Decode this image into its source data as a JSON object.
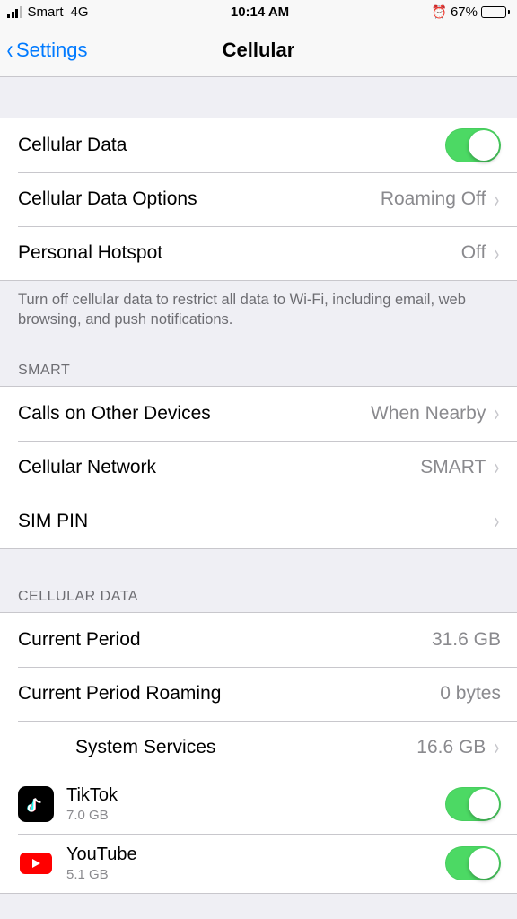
{
  "status": {
    "carrier": "Smart",
    "network": "4G",
    "time": "10:14 AM",
    "battery_pct": "67%"
  },
  "nav": {
    "back": "Settings",
    "title": "Cellular"
  },
  "main": {
    "cellular_data": "Cellular Data",
    "options_label": "Cellular Data Options",
    "options_value": "Roaming Off",
    "hotspot_label": "Personal Hotspot",
    "hotspot_value": "Off",
    "footer": "Turn off cellular data to restrict all data to Wi-Fi, including email, web browsing, and push notifications."
  },
  "smart_section": {
    "header": "SMART",
    "calls_label": "Calls on Other Devices",
    "calls_value": "When Nearby",
    "network_label": "Cellular Network",
    "network_value": "SMART",
    "simpin_label": "SIM PIN"
  },
  "data_section": {
    "header": "CELLULAR DATA",
    "period_label": "Current Period",
    "period_value": "31.6 GB",
    "roaming_label": "Current Period Roaming",
    "roaming_value": "0 bytes",
    "system_label": "System Services",
    "system_value": "16.6 GB",
    "apps": [
      {
        "name": "TikTok",
        "usage": "7.0 GB"
      },
      {
        "name": "YouTube",
        "usage": "5.1 GB"
      }
    ]
  }
}
